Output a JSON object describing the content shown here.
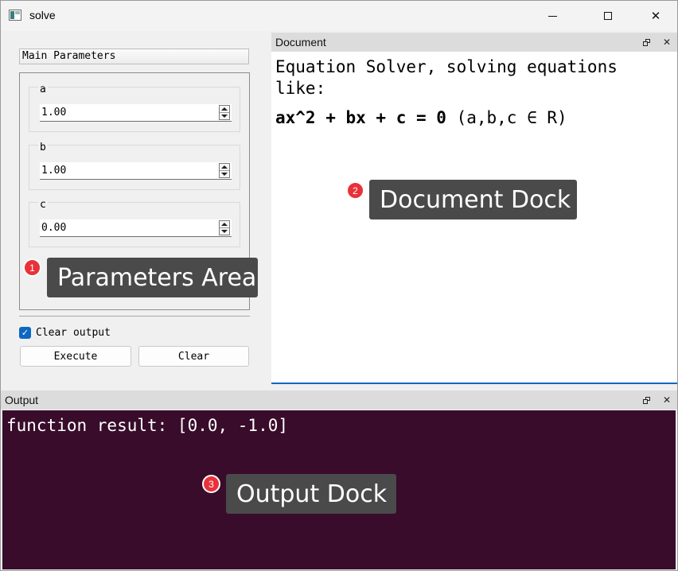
{
  "window": {
    "title": "solve"
  },
  "params": {
    "group_title": "Main Parameters",
    "fields": [
      {
        "label": "a",
        "value": "1.00"
      },
      {
        "label": "b",
        "value": "1.00"
      },
      {
        "label": "c",
        "value": "0.00"
      }
    ],
    "clear_output": {
      "label": "Clear output",
      "checked": true
    },
    "execute_label": "Execute",
    "clear_label": "Clear"
  },
  "document": {
    "dock_title": "Document",
    "line1": "Equation Solver, solving equations like:",
    "equation": "ax^2 + bx + c = 0",
    "domain": "(a,b,c ∈ R)"
  },
  "output": {
    "dock_title": "Output",
    "text": "function result: [0.0, -1.0]"
  },
  "annotations": [
    {
      "number": "1",
      "label": "Parameters Area"
    },
    {
      "number": "2",
      "label": "Document Dock"
    },
    {
      "number": "3",
      "label": "Output Dock"
    }
  ],
  "colors": {
    "accent": "#0b67c2",
    "output_background": "#380c2a",
    "badge": "#e8323a",
    "callout": "#4a4a4a"
  }
}
